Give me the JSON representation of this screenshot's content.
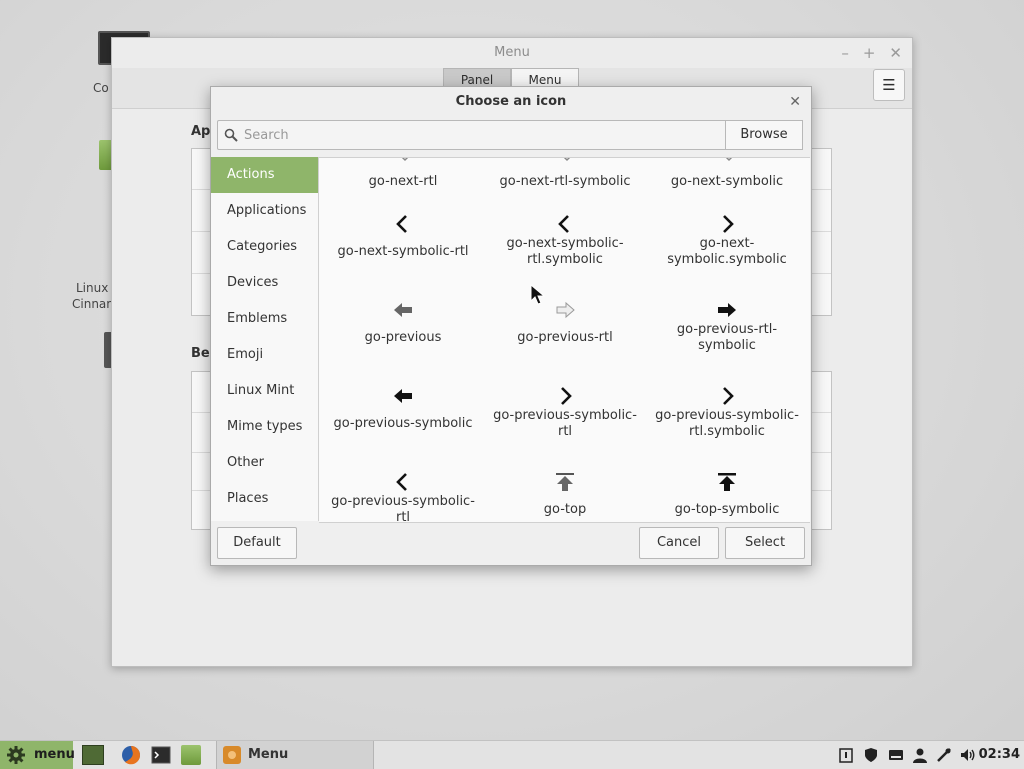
{
  "desktop": {
    "labels": [
      "Co",
      "Linux",
      "Cinnam"
    ]
  },
  "window": {
    "title": "Menu",
    "stack_tabs": [
      "Panel",
      "Menu"
    ],
    "headings": [
      "App",
      "Beh"
    ]
  },
  "dialog": {
    "title": "Choose an icon",
    "search": {
      "placeholder": "Search",
      "value": ""
    },
    "browse_label": "Browse",
    "categories": [
      {
        "label": "Actions",
        "selected": true
      },
      {
        "label": "Applications",
        "selected": false
      },
      {
        "label": "Categories",
        "selected": false
      },
      {
        "label": "Devices",
        "selected": false
      },
      {
        "label": "Emblems",
        "selected": false
      },
      {
        "label": "Emoji",
        "selected": false
      },
      {
        "label": "Linux Mint",
        "selected": false
      },
      {
        "label": "Mime types",
        "selected": false
      },
      {
        "label": "Other",
        "selected": false
      },
      {
        "label": "Places",
        "selected": false
      }
    ],
    "icons": [
      {
        "label": "go-next-rtl",
        "icon": "partial-icon"
      },
      {
        "label": "go-next-rtl-symbolic",
        "icon": "partial-icon"
      },
      {
        "label": "go-next-symbolic",
        "icon": "partial-icon"
      },
      {
        "label": "go-next-symbolic-rtl",
        "icon": "chevron-left-icon"
      },
      {
        "label": "go-next-symbolic-rtl.symbolic",
        "icon": "chevron-left-icon"
      },
      {
        "label": "go-next-symbolic.symbolic",
        "icon": "chevron-right-icon"
      },
      {
        "label": "go-previous",
        "icon": "arrow-left-gray-icon"
      },
      {
        "label": "go-previous-rtl",
        "icon": "arrow-right-faded-icon"
      },
      {
        "label": "go-previous-rtl-symbolic",
        "icon": "arrow-right-black-icon"
      },
      {
        "label": "go-previous-symbolic",
        "icon": "arrow-left-black-icon"
      },
      {
        "label": "go-previous-symbolic-rtl",
        "icon": "chevron-right-icon"
      },
      {
        "label": "go-previous-symbolic-rtl.symbolic",
        "icon": "chevron-right-icon"
      },
      {
        "label": "go-previous-symbolic-rtl",
        "icon": "chevron-left-icon"
      },
      {
        "label": "go-top",
        "icon": "arrow-top-gray-icon"
      },
      {
        "label": "go-top-symbolic",
        "icon": "arrow-top-black-icon"
      }
    ],
    "default_label": "Default",
    "cancel_label": "Cancel",
    "select_label": "Select"
  },
  "taskbar": {
    "menu_label": "menu",
    "task_label": "Menu",
    "clock": "02:34"
  },
  "colors": {
    "accent": "#8fb56a"
  }
}
